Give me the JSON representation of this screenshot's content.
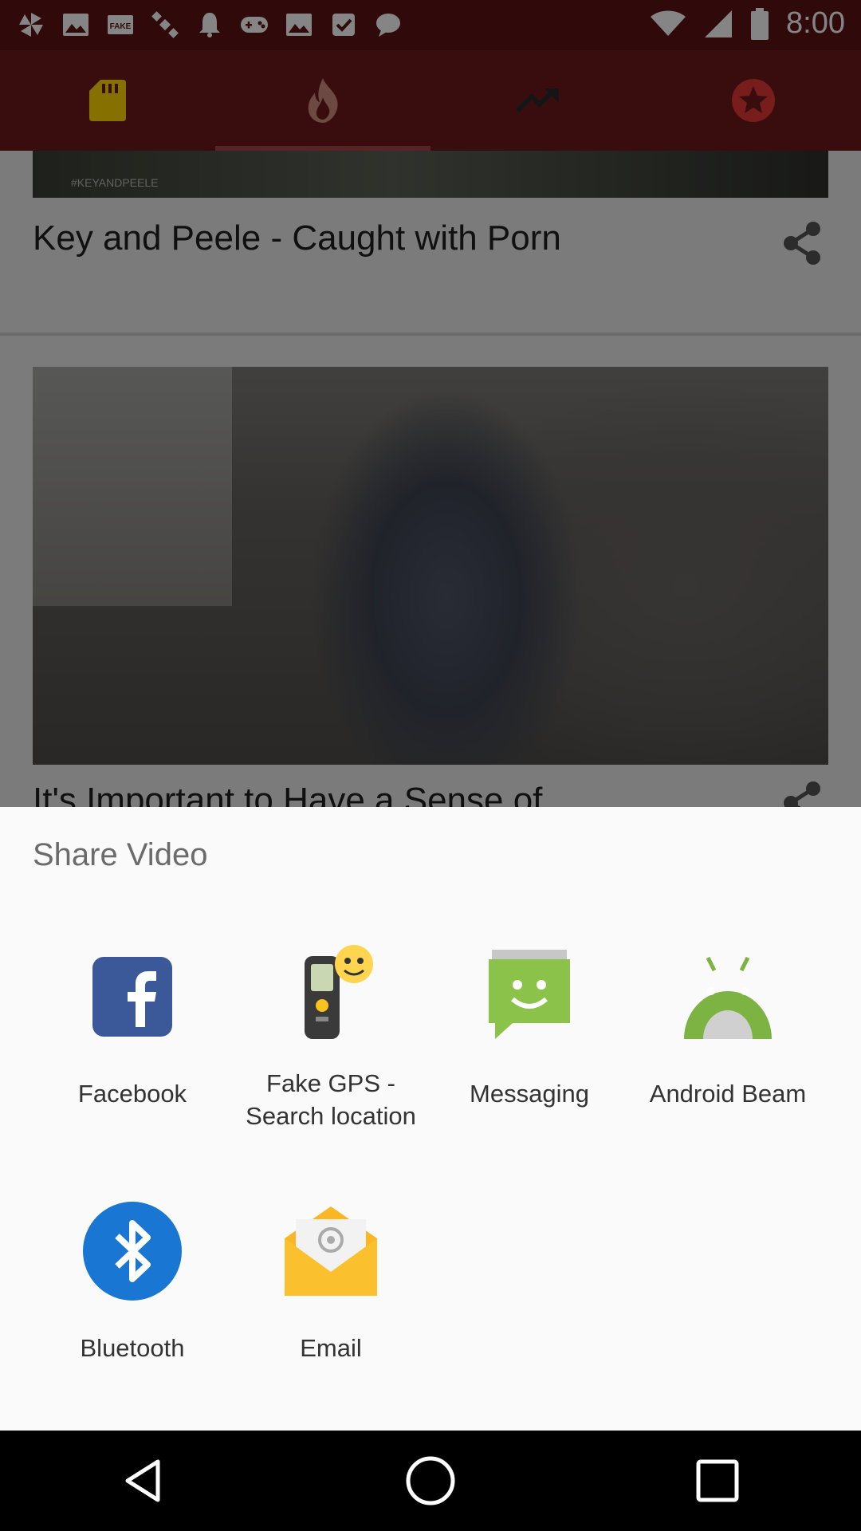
{
  "status_bar": {
    "time": "8:00"
  },
  "tabs": [
    {
      "name": "library"
    },
    {
      "name": "hot"
    },
    {
      "name": "trending"
    },
    {
      "name": "favorites"
    }
  ],
  "content": {
    "video1_title": "Key and Peele - Caught with Porn",
    "video1_thumb_text": "#KEYANDPEELE",
    "video2_title": "It's Important to Have a Sense of..."
  },
  "share_sheet": {
    "title": "Share Video",
    "apps": [
      {
        "label": "Facebook",
        "icon": "facebook-icon"
      },
      {
        "label": "Fake GPS -\nSearch location",
        "icon": "gps-icon"
      },
      {
        "label": "Messaging",
        "icon": "messaging-icon"
      },
      {
        "label": "Android Beam",
        "icon": "android-icon"
      },
      {
        "label": "Bluetooth",
        "icon": "bluetooth-icon"
      },
      {
        "label": "Email",
        "icon": "email-icon"
      }
    ]
  },
  "colors": {
    "app_bar": "#6e1919",
    "status_bar": "#5c1515",
    "facebook": "#3b5998",
    "messaging": "#8bc34a",
    "android": "#7cb342",
    "bluetooth": "#1976d2",
    "email": "#f9b724"
  }
}
